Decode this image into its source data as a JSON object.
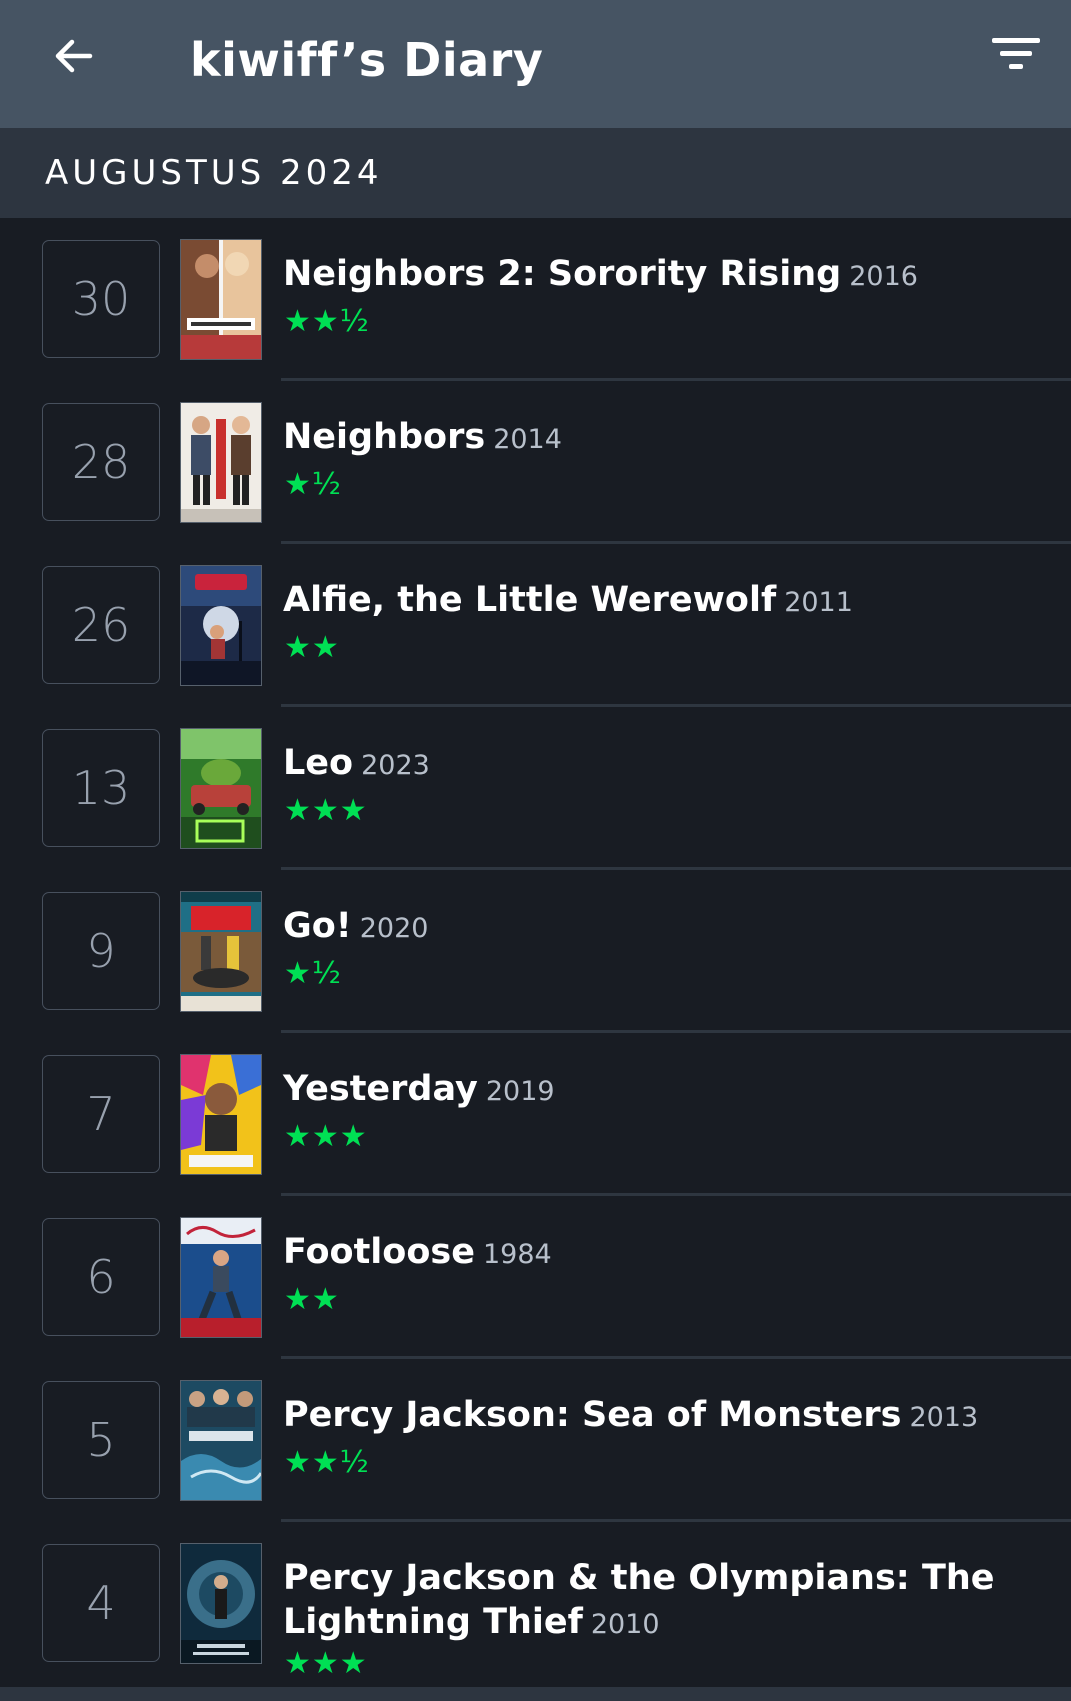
{
  "appbar": {
    "title": "kiwiff’s Diary",
    "back_icon": "arrow-left-icon",
    "filter_icon": "filter-icon",
    "background": "#465463"
  },
  "month": {
    "label": "AUGUSTUS 2024",
    "background": "#2d3540"
  },
  "colors": {
    "star": "#00e054",
    "background": "#181c23",
    "year": "#b8c0cb",
    "day": "#98a1ae"
  },
  "entries": [
    {
      "day": "30",
      "title": "Neighbors 2: Sorority Rising",
      "year": "2016",
      "rating": "★★½",
      "poster": "neighbors-2-poster"
    },
    {
      "day": "28",
      "title": "Neighbors",
      "year": "2014",
      "rating": "★½",
      "poster": "neighbors-poster"
    },
    {
      "day": "26",
      "title": "Alfie, the Little Werewolf",
      "year": "2011",
      "rating": "★★",
      "poster": "alfie-poster"
    },
    {
      "day": "13",
      "title": "Leo",
      "year": "2023",
      "rating": "★★★",
      "poster": "leo-poster"
    },
    {
      "day": "9",
      "title": "Go!",
      "year": "2020",
      "rating": "★½",
      "poster": "go-poster"
    },
    {
      "day": "7",
      "title": "Yesterday",
      "year": "2019",
      "rating": "★★★",
      "poster": "yesterday-poster"
    },
    {
      "day": "6",
      "title": "Footloose",
      "year": "1984",
      "rating": "★★",
      "poster": "footloose-poster"
    },
    {
      "day": "5",
      "title": "Percy Jackson: Sea of Monsters",
      "year": "2013",
      "rating": "★★½",
      "poster": "percy-jackson-sea-of-monsters-poster"
    },
    {
      "day": "4",
      "title": "Percy Jackson & the Olympians: The Lightning Thief",
      "year": "2010",
      "rating": "★★★",
      "poster": "percy-jackson-lightning-thief-poster"
    }
  ]
}
